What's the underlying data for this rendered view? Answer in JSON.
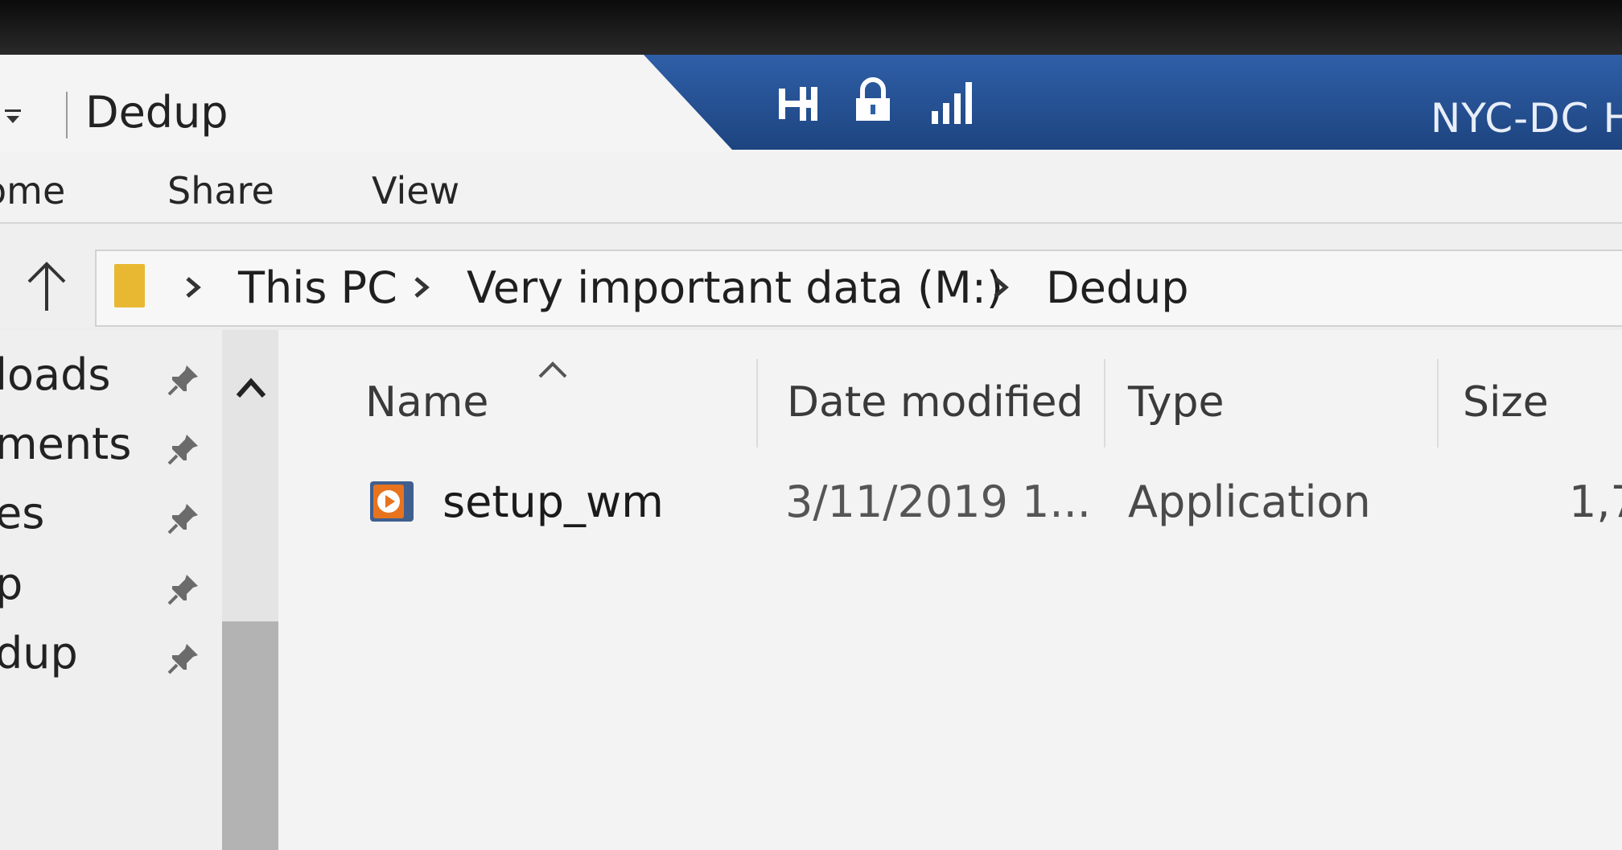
{
  "window": {
    "title": "Dedup"
  },
  "remote_bar": {
    "host": "NYC-DC H"
  },
  "ribbon": {
    "tabs": [
      "ome",
      "Share",
      "View"
    ]
  },
  "address": {
    "crumbs": [
      "This PC",
      "Very important data (M:)",
      "Dedup"
    ]
  },
  "nav": {
    "items": [
      "loads",
      "ments",
      "es",
      "p",
      "dup"
    ]
  },
  "columns": {
    "name": "Name",
    "date": "Date modified",
    "type": "Type",
    "size": "Size"
  },
  "files": [
    {
      "name": "setup_wm",
      "date": "3/11/2019 1...",
      "type": "Application",
      "size": "1,7"
    }
  ],
  "colors": {
    "remote_bar": "#2f5fa8",
    "folder": "#e8b832",
    "app_icon": "#e8731f"
  }
}
